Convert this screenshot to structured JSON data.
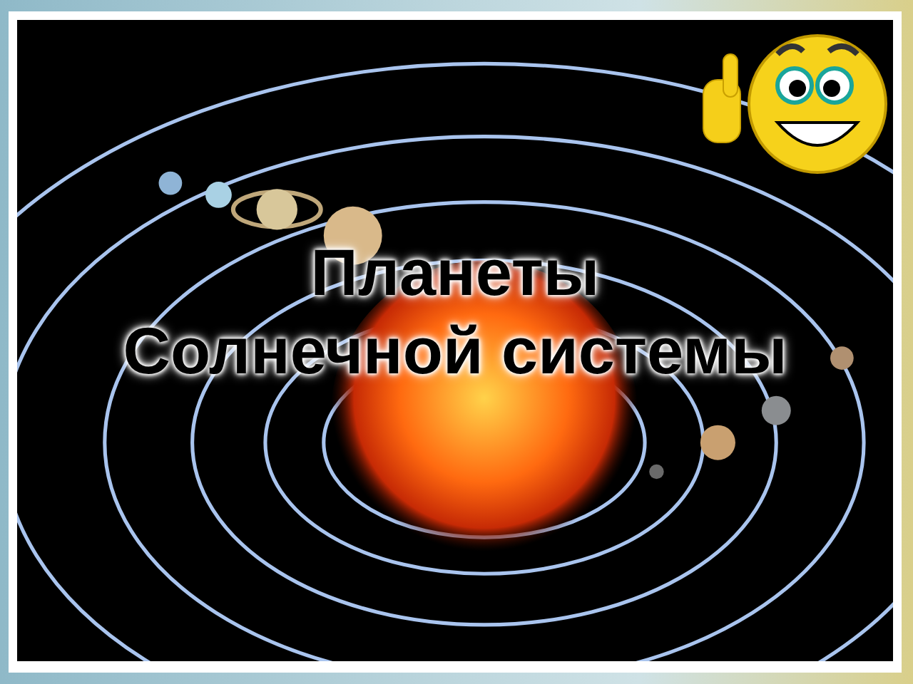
{
  "slide": {
    "title_lines": [
      "Планеты",
      "Солнечной системы"
    ]
  }
}
